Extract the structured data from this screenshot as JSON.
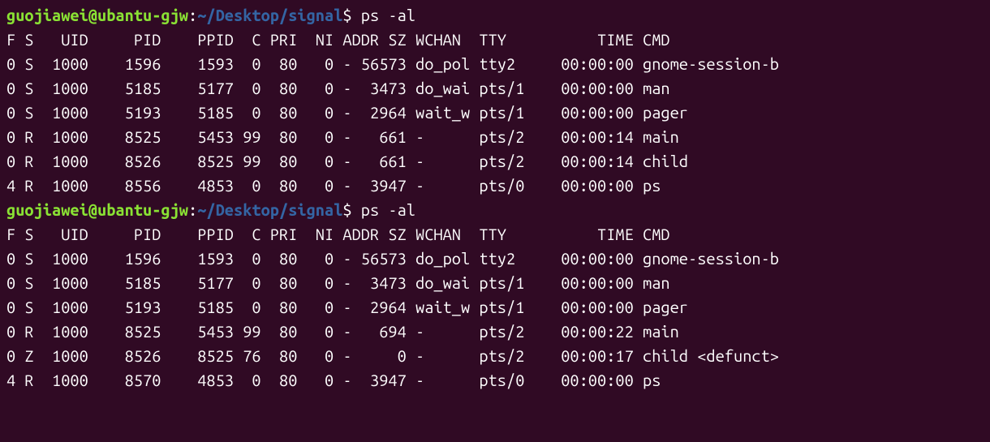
{
  "prompts": [
    {
      "user": "guojiawei@ubantu-gjw",
      "colon": ":",
      "path": "~/Desktop/signal",
      "dollar": "$",
      "command": " ps -al"
    },
    {
      "user": "guojiawei@ubantu-gjw",
      "colon": ":",
      "path": "~/Desktop/signal",
      "dollar": "$",
      "command": " ps -al"
    }
  ],
  "blocks": [
    {
      "header": "F S   UID     PID    PPID  C PRI  NI ADDR SZ WCHAN  TTY          TIME CMD",
      "rows": [
        "0 S  1000    1596    1593  0  80   0 - 56573 do_pol tty2     00:00:00 gnome-session-b",
        "0 S  1000    5185    5177  0  80   0 -  3473 do_wai pts/1    00:00:00 man",
        "0 S  1000    5193    5185  0  80   0 -  2964 wait_w pts/1    00:00:00 pager",
        "0 R  1000    8525    5453 99  80   0 -   661 -      pts/2    00:00:14 main",
        "0 R  1000    8526    8525 99  80   0 -   661 -      pts/2    00:00:14 child",
        "4 R  1000    8556    4853  0  80   0 -  3947 -      pts/0    00:00:00 ps"
      ]
    },
    {
      "header": "F S   UID     PID    PPID  C PRI  NI ADDR SZ WCHAN  TTY          TIME CMD",
      "rows": [
        "0 S  1000    1596    1593  0  80   0 - 56573 do_pol tty2     00:00:00 gnome-session-b",
        "0 S  1000    5185    5177  0  80   0 -  3473 do_wai pts/1    00:00:00 man",
        "0 S  1000    5193    5185  0  80   0 -  2964 wait_w pts/1    00:00:00 pager",
        "0 R  1000    8525    5453 99  80   0 -   694 -      pts/2    00:00:22 main",
        "0 Z  1000    8526    8525 76  80   0 -     0 -      pts/2    00:00:17 child <defunct>",
        "4 R  1000    8570    4853  0  80   0 -  3947 -      pts/0    00:00:00 ps"
      ]
    }
  ],
  "chart_data": {
    "type": "table",
    "tables": [
      {
        "columns": [
          "F",
          "S",
          "UID",
          "PID",
          "PPID",
          "C",
          "PRI",
          "NI",
          "ADDR",
          "SZ",
          "WCHAN",
          "TTY",
          "TIME",
          "CMD"
        ],
        "rows": [
          [
            "0",
            "S",
            "1000",
            "1596",
            "1593",
            "0",
            "80",
            "0",
            "-",
            "56573",
            "do_pol",
            "tty2",
            "00:00:00",
            "gnome-session-b"
          ],
          [
            "0",
            "S",
            "1000",
            "5185",
            "5177",
            "0",
            "80",
            "0",
            "-",
            "3473",
            "do_wai",
            "pts/1",
            "00:00:00",
            "man"
          ],
          [
            "0",
            "S",
            "1000",
            "5193",
            "5185",
            "0",
            "80",
            "0",
            "-",
            "2964",
            "wait_w",
            "pts/1",
            "00:00:00",
            "pager"
          ],
          [
            "0",
            "R",
            "1000",
            "8525",
            "5453",
            "99",
            "80",
            "0",
            "-",
            "661",
            "-",
            "pts/2",
            "00:00:14",
            "main"
          ],
          [
            "0",
            "R",
            "1000",
            "8526",
            "8525",
            "99",
            "80",
            "0",
            "-",
            "661",
            "-",
            "pts/2",
            "00:00:14",
            "child"
          ],
          [
            "4",
            "R",
            "1000",
            "8556",
            "4853",
            "0",
            "80",
            "0",
            "-",
            "3947",
            "-",
            "pts/0",
            "00:00:00",
            "ps"
          ]
        ]
      },
      {
        "columns": [
          "F",
          "S",
          "UID",
          "PID",
          "PPID",
          "C",
          "PRI",
          "NI",
          "ADDR",
          "SZ",
          "WCHAN",
          "TTY",
          "TIME",
          "CMD"
        ],
        "rows": [
          [
            "0",
            "S",
            "1000",
            "1596",
            "1593",
            "0",
            "80",
            "0",
            "-",
            "56573",
            "do_pol",
            "tty2",
            "00:00:00",
            "gnome-session-b"
          ],
          [
            "0",
            "S",
            "1000",
            "5185",
            "5177",
            "0",
            "80",
            "0",
            "-",
            "3473",
            "do_wai",
            "pts/1",
            "00:00:00",
            "man"
          ],
          [
            "0",
            "S",
            "1000",
            "5193",
            "5185",
            "0",
            "80",
            "0",
            "-",
            "2964",
            "wait_w",
            "pts/1",
            "00:00:00",
            "pager"
          ],
          [
            "0",
            "R",
            "1000",
            "8525",
            "5453",
            "99",
            "80",
            "0",
            "-",
            "694",
            "-",
            "pts/2",
            "00:00:22",
            "main"
          ],
          [
            "0",
            "Z",
            "1000",
            "8526",
            "8525",
            "76",
            "80",
            "0",
            "-",
            "0",
            "-",
            "pts/2",
            "00:00:17",
            "child <defunct>"
          ],
          [
            "4",
            "R",
            "1000",
            "8570",
            "4853",
            "0",
            "80",
            "0",
            "-",
            "3947",
            "-",
            "pts/0",
            "00:00:00",
            "ps"
          ]
        ]
      }
    ]
  }
}
